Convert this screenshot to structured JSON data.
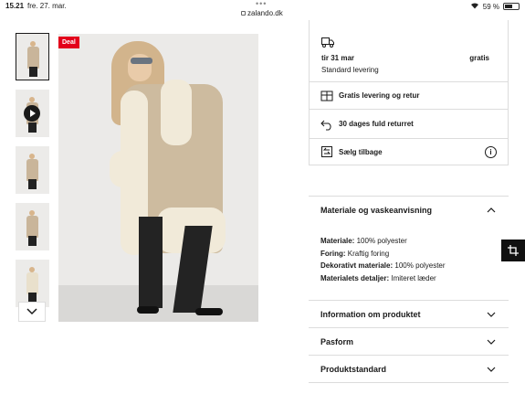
{
  "status_bar": {
    "time": "15.21",
    "date": "fre. 27. mar.",
    "url": "zalando.dk",
    "battery": "59 %",
    "battery_level": 0.59
  },
  "product_images": {
    "deal_badge": "Deal",
    "thumbnails": [
      "thumb-1",
      "thumb-video",
      "thumb-3",
      "thumb-4",
      "thumb-5"
    ]
  },
  "delivery": {
    "date": "tir 31 mar",
    "price": "gratis",
    "method": "Standard levering"
  },
  "perks": {
    "free_delivery_return": "Gratis levering og retur",
    "return_period": "30 dages fuld returret",
    "sell_back": "Sælg tilbage"
  },
  "accordions": {
    "material": {
      "title": "Materiale og vaskeanvisning",
      "rows": [
        {
          "key": "Materiale:",
          "value": "100% polyester"
        },
        {
          "key": "Foring:",
          "value": "Kraftig foring"
        },
        {
          "key": "Dekorativt materiale:",
          "value": "100% polyester"
        },
        {
          "key": "Materialets detaljer:",
          "value": "Imiteret læder"
        }
      ]
    },
    "info": {
      "title": "Information om produktet"
    },
    "fit": {
      "title": "Pasform"
    },
    "standard": {
      "title": "Produktstandard"
    }
  },
  "colors": {
    "deal_red": "#e3001b",
    "fab": "#111111"
  }
}
